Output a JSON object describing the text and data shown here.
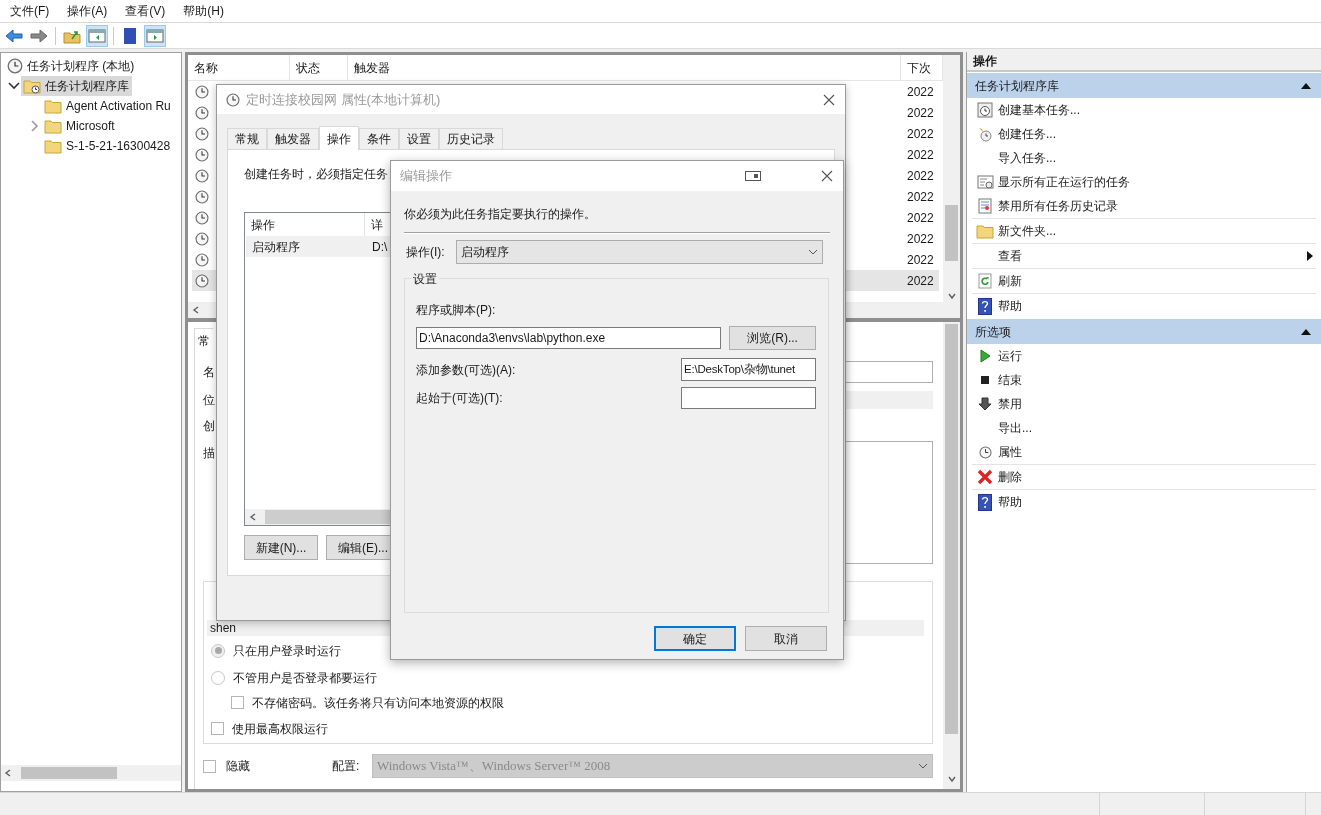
{
  "menu": [
    {
      "label": "文件(F)"
    },
    {
      "label": "操作(A)"
    },
    {
      "label": "查看(V)"
    },
    {
      "label": "帮助(H)"
    }
  ],
  "toolbar": [
    {
      "pressed": false
    },
    {
      "pressed": false
    },
    {
      "pressed": false
    },
    {
      "pressed": true
    },
    {
      "pressed": false
    },
    {
      "pressed": true
    }
  ],
  "tree": {
    "label": "任务计划程序 (本地)",
    "selected": false,
    "children": [
      {
        "label": "任务计划程序库",
        "selected": true,
        "expanded": true,
        "children": [
          {
            "label": "Agent Activation Ru",
            "selected": false
          },
          {
            "label": "Microsoft",
            "selected": false,
            "expanded": false
          },
          {
            "label": "S-1-5-21-16300428",
            "selected": false
          }
        ]
      }
    ]
  },
  "task_list": {
    "columns": [
      "名称",
      "状态",
      "触发器",
      "下次"
    ],
    "rows": [
      {
        "next_run": "2022",
        "selected": false
      },
      {
        "next_run": "2022",
        "selected": false
      },
      {
        "next_run": "2022",
        "selected": false
      },
      {
        "next_run": "2022",
        "selected": false
      },
      {
        "next_run": "2022",
        "selected": false
      },
      {
        "next_run": "2022",
        "selected": false
      },
      {
        "next_run": "2022",
        "selected": false
      },
      {
        "next_run": "2022",
        "selected": false
      },
      {
        "next_run": "2022",
        "selected": false
      },
      {
        "next_run": "2022",
        "selected": true
      }
    ]
  },
  "details": {
    "tab": "常",
    "labels": [
      "名",
      "位",
      "创",
      "描"
    ],
    "account": "shen",
    "radios": [
      {
        "label": "只在用户登录时运行",
        "selected": true
      },
      {
        "label": "不管用户是否登录都要运行",
        "selected": false
      }
    ],
    "store_password": {
      "label": "不存储密码。该任务将只有访问本地资源的权限",
      "checked": false
    },
    "highest_privileges": {
      "label": "使用最高权限运行",
      "checked": false
    },
    "hidden": {
      "label": "隐藏",
      "checked": false
    },
    "config_label": "配置:",
    "config_value": "Windows Vista™、Windows Server™ 2008"
  },
  "properties_dialog": {
    "title": "定时连接校园网 属性(本地计算机)",
    "tabs": [
      {
        "label": "常规",
        "selected": false
      },
      {
        "label": "触发器",
        "selected": false
      },
      {
        "label": "操作",
        "selected": true
      },
      {
        "label": "条件",
        "selected": false
      },
      {
        "label": "设置",
        "selected": false
      },
      {
        "label": "历史记录",
        "selected": false
      }
    ],
    "intro": "创建任务时，必须指定任务",
    "columns": [
      "操作",
      "详"
    ],
    "rows": [
      {
        "action": "启动程序",
        "detail": "D:\\",
        "selected": true
      }
    ],
    "buttons": [
      "新建(N)...",
      "编辑(E)..."
    ]
  },
  "edit_dialog": {
    "title": "编辑操作",
    "intro": "你必须为此任务指定要执行的操作。",
    "action_label": "操作(I):",
    "action_value": "启动程序",
    "group": "设置",
    "program_label": "程序或脚本(P):",
    "program_value": "D:\\Anaconda3\\envs\\lab\\python.exe",
    "browse": "浏览(R)...",
    "args_label": "添加参数(可选)(A):",
    "args_value": "E:\\DeskTop\\杂物\\tunet",
    "start_label": "起始于(可选)(T):",
    "ok": "确定",
    "cancel": "取消"
  },
  "actions_pane": {
    "title": "操作",
    "sections": [
      {
        "title": "任务计划程序库",
        "expanded": true,
        "groups": [
          [
            {
              "label": "创建基本任务...",
              "submenu": false
            },
            {
              "label": "创建任务...",
              "submenu": false
            },
            {
              "label": "导入任务...",
              "submenu": false
            },
            {
              "label": "显示所有正在运行的任务",
              "submenu": false
            },
            {
              "label": "禁用所有任务历史记录",
              "submenu": false
            }
          ],
          [
            {
              "label": "新文件夹...",
              "submenu": false
            }
          ],
          [
            {
              "label": "查看",
              "submenu": true
            }
          ],
          [
            {
              "label": "刷新",
              "submenu": false
            }
          ],
          [
            {
              "label": "帮助",
              "submenu": false
            }
          ]
        ]
      },
      {
        "title": "所选项",
        "expanded": true,
        "groups": [
          [
            {
              "label": "运行",
              "submenu": false
            },
            {
              "label": "结束",
              "submenu": false
            },
            {
              "label": "禁用",
              "submenu": false
            },
            {
              "label": "导出...",
              "submenu": false
            },
            {
              "label": "属性",
              "submenu": false
            }
          ],
          [
            {
              "label": "删除",
              "submenu": false
            }
          ],
          [
            {
              "label": "帮助",
              "submenu": false
            }
          ]
        ]
      }
    ]
  }
}
